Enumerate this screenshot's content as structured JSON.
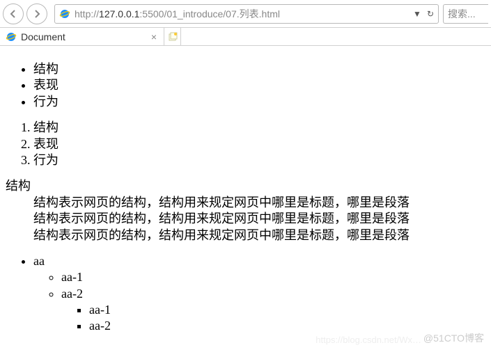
{
  "toolbar": {
    "url_prefix": "http://",
    "url_host": "127.0.0.1",
    "url_port_path": ":5500/01_introduce/07.列表.html",
    "search_placeholder": "搜索..."
  },
  "tabs": {
    "active_title": "Document"
  },
  "page": {
    "unordered": [
      "结构",
      "表现",
      "行为"
    ],
    "ordered": [
      "结构",
      "表现",
      "行为"
    ],
    "dl_term": "结构",
    "dl_desc": "结构表示网页的结构，结构用来规定网页中哪里是标题，哪里是段落",
    "nested": {
      "top": "aa",
      "level2": [
        "aa-1",
        "aa-2"
      ],
      "level3": [
        "aa-1",
        "aa-2"
      ]
    }
  },
  "watermarks": {
    "w1": "@51CTO博客",
    "w2": "https://blog.csdn.net/Wx…"
  }
}
